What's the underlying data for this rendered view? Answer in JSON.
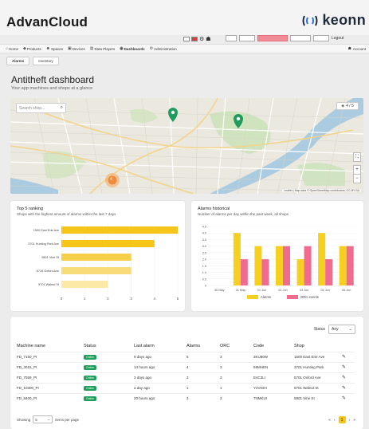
{
  "header": {
    "app_title": "AdvanCloud",
    "brand_name": "keonn",
    "brand_color": "#1e2a3a"
  },
  "filters": {
    "apply_label": "Apply",
    "logout_label": "Logout"
  },
  "nav": {
    "items": [
      {
        "icon": "home-icon",
        "label": "Home"
      },
      {
        "icon": "tag-icon",
        "label": "Products"
      },
      {
        "icon": "people-icon",
        "label": "Spaces"
      },
      {
        "icon": "device-icon",
        "label": "Devices"
      },
      {
        "icon": "chart-icon",
        "label": "Data Players"
      },
      {
        "icon": "gauge-icon",
        "label": "Dashboards"
      },
      {
        "icon": "gear-icon",
        "label": "Administration"
      }
    ],
    "account_label": "Account"
  },
  "subtabs": [
    "Alarms",
    "Inventory"
  ],
  "page": {
    "title": "Antitheft dashboard",
    "subtitle": "Your app machines and shops at a glance"
  },
  "map": {
    "search_placeholder": "Search shop...",
    "control_label": "4 / 5",
    "zoom_in": "+",
    "zoom_out": "−",
    "cluster_count": "4",
    "attribution": "Leaflet | Map data © OpenStreetMap contributors, CC-BY-SA"
  },
  "ranking": {
    "title": "Top 5 ranking",
    "subtitle": "Shops with the highest amount of alarms within the last 7 days",
    "chart_data": {
      "type": "bar",
      "orientation": "horizontal",
      "categories": [
        "1500 East Erie Ave",
        "3701 Hunting Park Ave",
        "5801 Vine St",
        "6716 Oxford Ave",
        "5701 Walnut St"
      ],
      "values": [
        5,
        4,
        3,
        3,
        2
      ],
      "xlim": [
        0,
        5
      ],
      "x_ticks": [
        "0",
        "1",
        "2",
        "3",
        "4",
        "5"
      ],
      "colors": [
        "#f5c518",
        "#f5c518",
        "#f7d04a",
        "#f9dc7a",
        "#fce9a8"
      ]
    }
  },
  "historical": {
    "title": "Alarms historical",
    "subtitle": "Number of alarms per day within the past week, all shops",
    "chart_data": {
      "type": "bar",
      "categories": [
        "30 May",
        "31 May",
        "01 Jun",
        "02 Jun",
        "03 Jun",
        "04 Jun",
        "05 Jun"
      ],
      "series": [
        {
          "name": "Alarms",
          "values": [
            0,
            4,
            3,
            3,
            2,
            4,
            3
          ],
          "color": "#f5d020"
        },
        {
          "name": "ORC events",
          "values": [
            0,
            2,
            2,
            3,
            3,
            2,
            3
          ],
          "color": "#f06c8e"
        }
      ],
      "ylim": [
        0,
        4.5
      ],
      "y_ticks": [
        "0",
        "0.5",
        "1.0",
        "1.5",
        "2.0",
        "2.5",
        "3.0",
        "3.5",
        "4.0",
        "4.5"
      ],
      "legend": "bottom"
    }
  },
  "table": {
    "status_label": "Status",
    "status_value": "Any",
    "columns": [
      "Machine name",
      "Status",
      "Last alarm",
      "Alarms",
      "ORC",
      "Code",
      "Shop"
    ],
    "rows": [
      {
        "name": "FD_7150_PI",
        "status": "Online",
        "last": "9 days ago",
        "alarms": "5",
        "orc": "3",
        "code": "3KU80W",
        "shop": "1500 East Erie Ave"
      },
      {
        "name": "FD_3015_PI",
        "status": "Online",
        "last": "14 hours ago",
        "alarms": "4",
        "orc": "3",
        "code": "69MHEN",
        "shop": "3701 Hunting Park"
      },
      {
        "name": "FD_7559_PI",
        "status": "Online",
        "last": "3 days ago",
        "alarms": "3",
        "orc": "3",
        "code": "E4C3LI",
        "shop": "5701 Oxford Ave"
      },
      {
        "name": "FD_10300_PI",
        "status": "Online",
        "last": "a day ago",
        "alarms": "1",
        "orc": "1",
        "code": "Y2V03H",
        "shop": "5701 Walnut St"
      },
      {
        "name": "FD_8400_PI",
        "status": "Online",
        "last": "20 hours ago",
        "alarms": "3",
        "orc": "3",
        "code": "7NMKUI",
        "shop": "5801 Vine St"
      }
    ],
    "showing_label": "Showing",
    "per_page_value": "5",
    "per_page_label": "items per page",
    "current_page": "1",
    "online_color": "#1e9e5a"
  }
}
